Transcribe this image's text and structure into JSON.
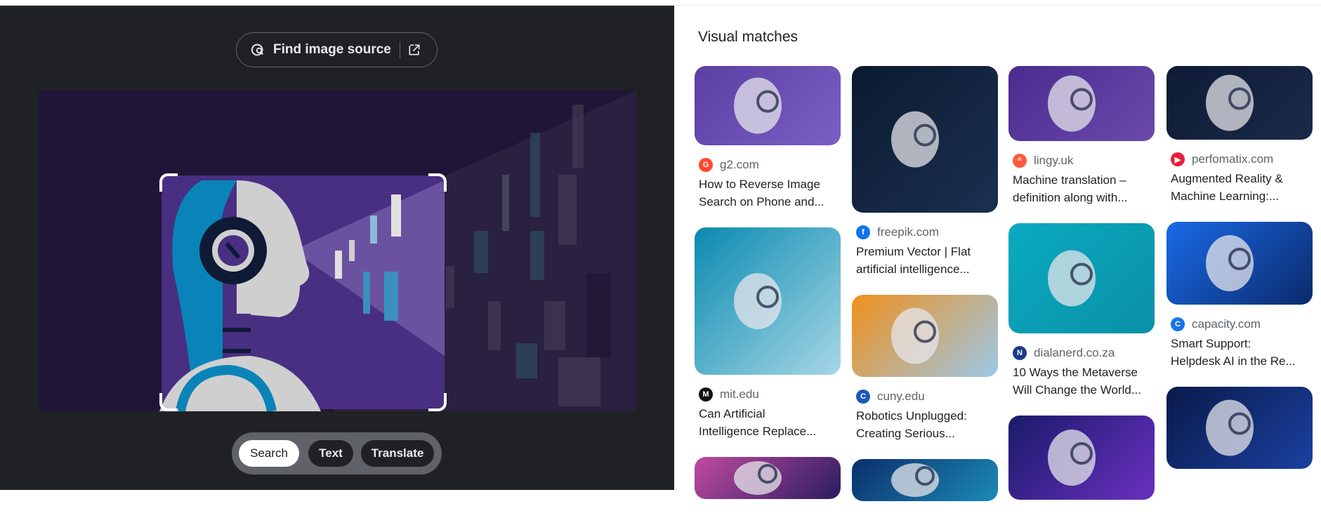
{
  "left_panel": {
    "find_source_label": "Find image source",
    "modes": [
      {
        "label": "Search",
        "active": true
      },
      {
        "label": "Text",
        "active": false
      },
      {
        "label": "Translate",
        "active": false
      }
    ]
  },
  "visual_matches": {
    "heading": "Visual matches",
    "columns": [
      [
        {
          "site": "g2.com",
          "title": [
            "How to Reverse Image",
            "Search on Phone and..."
          ],
          "favicon_color": "#ff492c",
          "colors": [
            "#5b3fa3",
            "#7b5fc4"
          ]
        },
        {
          "site": "mit.edu",
          "title": [
            "Can Artificial",
            "Intelligence Replace..."
          ],
          "favicon_color": "#111111",
          "colors": [
            "#0a8ab0",
            "#a7d7e6"
          ]
        },
        {
          "site": "",
          "title": [],
          "favicon_color": "",
          "colors": [
            "#c04aa0",
            "#2a1c60"
          ]
        }
      ],
      [
        {
          "site": "freepik.com",
          "title": [
            "Premium Vector | Flat",
            "artificial intelligence..."
          ],
          "favicon_color": "#1273eb",
          "colors": [
            "#0b1a30",
            "#1b3050"
          ]
        },
        {
          "site": "cuny.edu",
          "title": [
            "Robotics Unplugged:",
            "Creating Serious..."
          ],
          "favicon_color": "#1a5ab8",
          "colors": [
            "#f0901c",
            "#9cc8e8"
          ]
        },
        {
          "site": "",
          "title": [],
          "favicon_color": "",
          "colors": [
            "#0b2f6a",
            "#1b8ab8"
          ]
        }
      ],
      [
        {
          "site": "lingy.uk",
          "title": [
            "Machine translation –",
            "definition along with..."
          ],
          "favicon_color": "#ff5a3c",
          "colors": [
            "#4a2c8f",
            "#6b4aaa"
          ]
        },
        {
          "site": "dialanerd.co.za",
          "title": [
            "10 Ways the Metaverse",
            "Will Change the World..."
          ],
          "favicon_color": "#1a3a8a",
          "colors": [
            "#0aaac0",
            "#0a90a8"
          ]
        },
        {
          "site": "",
          "title": [],
          "favicon_color": "",
          "colors": [
            "#1a1a6a",
            "#6a30c0"
          ]
        }
      ],
      [
        {
          "site": "perfomatix.com",
          "title": [
            "Augmented Reality &",
            "Machine Learning:..."
          ],
          "favicon_color": "#e8203a",
          "colors": [
            "#0f1b36",
            "#1a2a48"
          ]
        },
        {
          "site": "capacity.com",
          "title": [
            "Smart Support:",
            "Helpdesk AI in the Re..."
          ],
          "favicon_color": "#1a73e8",
          "colors": [
            "#1a6ae8",
            "#0a2a6a"
          ]
        },
        {
          "site": "",
          "title": [],
          "favicon_color": "",
          "colors": [
            "#0a1a4a",
            "#1a40a0"
          ]
        }
      ]
    ]
  }
}
